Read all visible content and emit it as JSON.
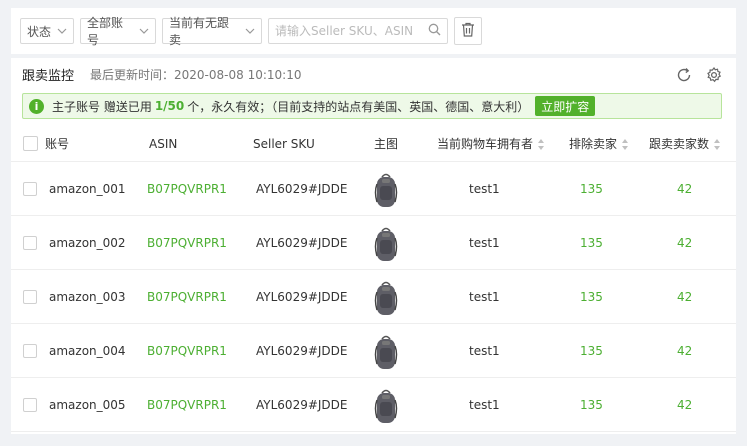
{
  "filters": {
    "status": "状态",
    "account": "全部账号",
    "follow": "当前有无跟卖",
    "search_placeholder": "请输入Seller SKU、ASIN"
  },
  "panel": {
    "title": "跟卖监控",
    "updated_label": "最后更新时间：2020-08-08 10:10:10"
  },
  "notice": {
    "prefix": "主子账号 赠送已用",
    "used": "1/50",
    "suffix": "个，永久有效；（目前支持的站点有美国、英国、德国、意大利）",
    "button": "立即扩容"
  },
  "table": {
    "headers": {
      "account": "账号",
      "asin": "ASIN",
      "sku": "Seller SKU",
      "image": "主图",
      "owner": "当前购物车拥有者",
      "excluded": "排除卖家",
      "followers": "跟卖卖家数"
    },
    "rows": [
      {
        "account": "amazon_001",
        "asin": "B07PQVRPR1",
        "sku": "AYL6029#JDDE",
        "owner": "test1",
        "excluded": "135",
        "followers": "42"
      },
      {
        "account": "amazon_002",
        "asin": "B07PQVRPR1",
        "sku": "AYL6029#JDDE",
        "owner": "test1",
        "excluded": "135",
        "followers": "42"
      },
      {
        "account": "amazon_003",
        "asin": "B07PQVRPR1",
        "sku": "AYL6029#JDDE",
        "owner": "test1",
        "excluded": "135",
        "followers": "42"
      },
      {
        "account": "amazon_004",
        "asin": "B07PQVRPR1",
        "sku": "AYL6029#JDDE",
        "owner": "test1",
        "excluded": "135",
        "followers": "42"
      },
      {
        "account": "amazon_005",
        "asin": "B07PQVRPR1",
        "sku": "AYL6029#JDDE",
        "owner": "test1",
        "excluded": "135",
        "followers": "42"
      }
    ]
  },
  "colors": {
    "accent": "#52b12b",
    "notice_bg": "#eef9e8"
  }
}
